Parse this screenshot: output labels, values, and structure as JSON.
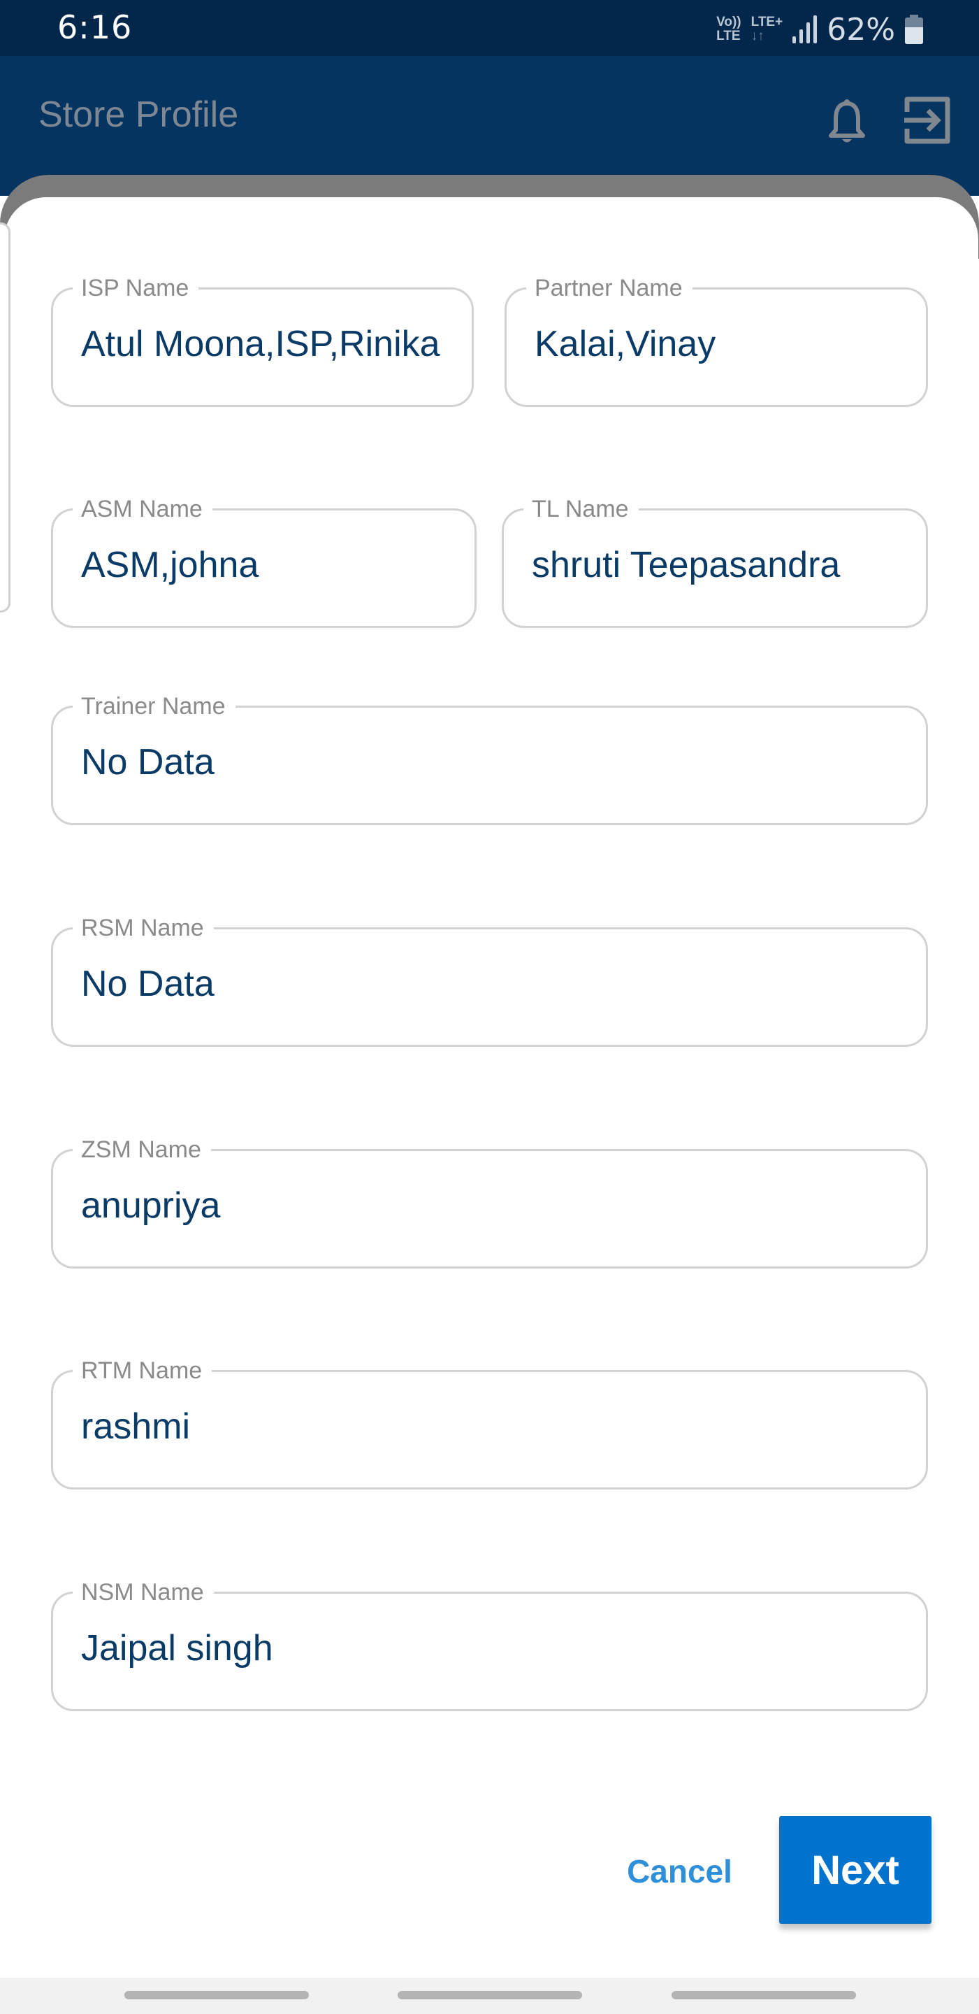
{
  "status_bar": {
    "time": "6:16",
    "network_top": "Vo)) LTE+",
    "network_line1": "Vo))",
    "network_line2": "LTE",
    "network_type": "LTE+",
    "data_arrows": "↓↑",
    "battery_percent": "62%",
    "battery_level": 0.62,
    "signal_bars": 4
  },
  "app_bar": {
    "title": "Store Profile",
    "icons": [
      "bell-icon",
      "logout-icon"
    ]
  },
  "form": {
    "fields": [
      {
        "label": "ISP Name",
        "value": "Atul Moona,ISP,Rinika"
      },
      {
        "label": "Partner Name",
        "value": "Kalai,Vinay"
      },
      {
        "label": "ASM Name",
        "value": "ASM,johna"
      },
      {
        "label": "TL Name",
        "value": "shruti Teepasandra"
      },
      {
        "label": "Trainer Name",
        "value": "No Data"
      },
      {
        "label": "RSM Name",
        "value": "No Data"
      },
      {
        "label": "ZSM Name",
        "value": "anupriya"
      },
      {
        "label": "RTM Name",
        "value": "rashmi"
      },
      {
        "label": "NSM Name",
        "value": "Jaipal singh"
      }
    ]
  },
  "actions": {
    "cancel_label": "Cancel",
    "next_label": "Next"
  },
  "colors": {
    "status_bar": "#03264b",
    "app_bar": "#04345f",
    "value_text": "#0a3a66",
    "label_text": "#8a8a8a",
    "primary_button": "#0273cc",
    "link": "#2f8fd8"
  }
}
